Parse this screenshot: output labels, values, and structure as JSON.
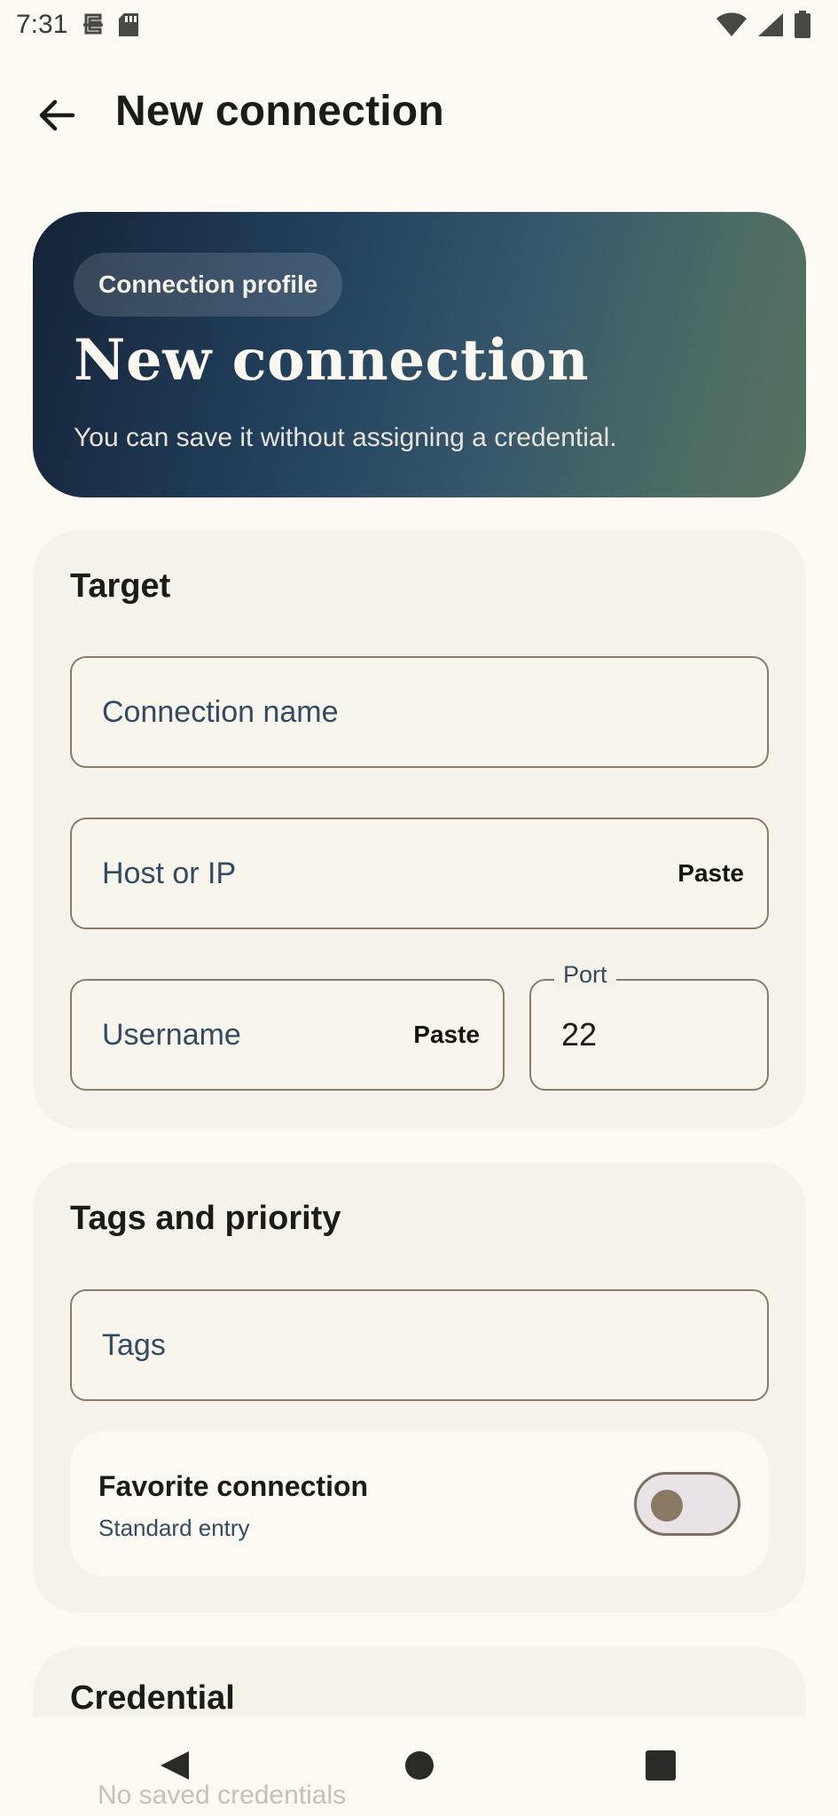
{
  "status_bar": {
    "time": "7:31",
    "icons": [
      "sim-strike-icon",
      "sd-card-icon",
      "wifi-icon",
      "signal-icon",
      "battery-icon"
    ]
  },
  "app_bar": {
    "back_icon": "arrow-left-icon",
    "title": "New connection"
  },
  "hero": {
    "chip": "Connection profile",
    "title": "New connection",
    "subtitle": "You can save it without assigning a credential."
  },
  "target": {
    "title": "Target",
    "connection_name_placeholder": "Connection name",
    "host_placeholder": "Host or IP",
    "host_paste": "Paste",
    "username_placeholder": "Username",
    "username_paste": "Paste",
    "port_label": "Port",
    "port_value": "22"
  },
  "tags": {
    "title": "Tags and priority",
    "tags_placeholder": "Tags",
    "favorite_title": "Favorite connection",
    "favorite_sub": "Standard entry",
    "favorite_on": false
  },
  "credential": {
    "title": "Credential",
    "empty_text": "No saved credentials"
  },
  "nav": {
    "back_icon": "triangle-back-icon",
    "home_icon": "circle-home-icon",
    "recents_icon": "square-recents-icon"
  },
  "colors": {
    "background": "#fcf9f3",
    "card": "#f5f2ea",
    "outline": "#8a7a66",
    "hero_start": "#152338",
    "hero_end": "#57735f"
  }
}
